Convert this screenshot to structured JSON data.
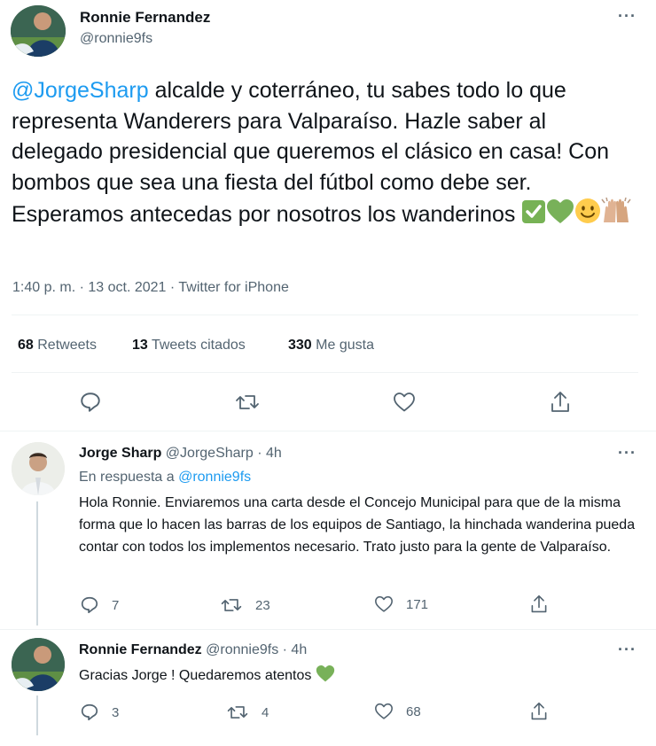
{
  "main_tweet": {
    "author_name": "Ronnie Fernandez",
    "author_handle": "@ronnie9fs",
    "mention": "@JorgeSharp",
    "body": " alcalde y coterráneo, tu sabes todo lo que representa Wanderers para Valparaíso. Hazle saber al delegado presidencial que queremos el clásico en casa! Con bombos que sea una fiesta del fútbol como debe ser. Esperamos antecedas por nosotros los wanderinos ",
    "timestamp": "1:40 p. m. · 13 oct. 2021 · Twitter for iPhone",
    "stats": {
      "retweets_count": "68",
      "retweets_label": " Retweets",
      "quotes_count": "13",
      "quotes_label": " Tweets citados",
      "likes_count": "330",
      "likes_label": " Me gusta"
    },
    "emojis": [
      "check-mark-icon",
      "green-heart-icon",
      "smiling-face-icon",
      "raising-hands-icon"
    ]
  },
  "replies": [
    {
      "author_name": "Jorge Sharp",
      "author_meta": " @JorgeSharp · 4h",
      "replying_prefix": "En respuesta a ",
      "replying_handle": "@ronnie9fs",
      "body": "Hola Ronnie. Enviaremos una carta desde el Concejo Municipal para que de la misma forma que lo hacen las barras de los equipos de Santiago, la hinchada wanderina pueda contar con todos los implementos necesario. Trato justo para la gente de Valparaíso.",
      "replies_count": "7",
      "retweets_count": "23",
      "likes_count": "171"
    },
    {
      "author_name": "Ronnie Fernandez",
      "author_meta": " @ronnie9fs · 4h",
      "body": "Gracias Jorge ! Quedaremos atentos ",
      "replies_count": "3",
      "retweets_count": "4",
      "likes_count": "68"
    }
  ],
  "colors": {
    "link": "#1d9bf0",
    "muted": "#536471",
    "text": "#0f1419",
    "green_heart": "#78b159",
    "check_green": "#77b255"
  }
}
